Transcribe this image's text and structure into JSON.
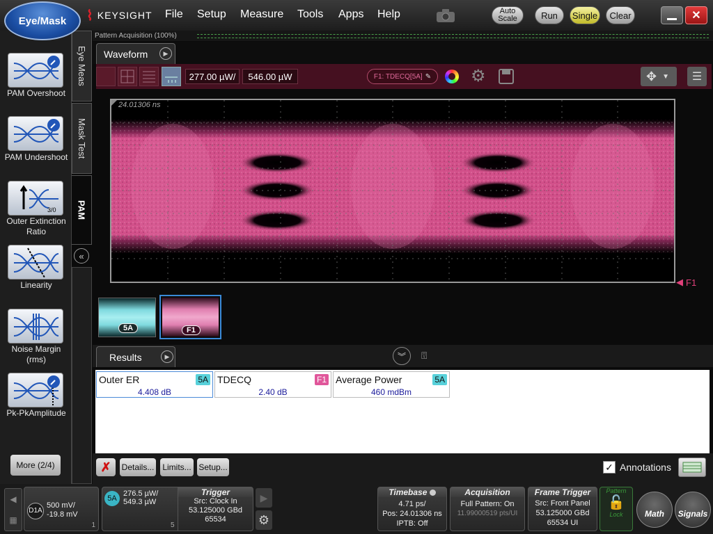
{
  "app": {
    "mode_button": "Eye/Mask",
    "brand": "KEYSIGHT"
  },
  "menu": [
    "File",
    "Setup",
    "Measure",
    "Tools",
    "Apps",
    "Help"
  ],
  "controls": {
    "auto_scale": "Auto Scale",
    "run": "Run",
    "single": "Single",
    "clear": "Clear"
  },
  "left_measurements": [
    {
      "label": "PAM Overshoot"
    },
    {
      "label": "PAM Undershoot"
    },
    {
      "label": "Outer Extinction Ratio"
    },
    {
      "label": "Linearity"
    },
    {
      "label": "Noise Margin (rms)"
    },
    {
      "label": "Pk-PkAmplitude"
    }
  ],
  "more_button": "More (2/4)",
  "vertical_tabs": [
    "Eye Meas",
    "Mask Test",
    "PAM"
  ],
  "pattern_bar": "Pattern Acquisition  (100%)",
  "waveform": {
    "tab": "Waveform",
    "scale_value": "277.00 µW/",
    "offset_value": "546.00 µW",
    "function_label": "F1: TDECQ[5A]",
    "timestamp": "24.01306 ns",
    "marker_label": "F1",
    "thumbnails": [
      {
        "label": "5A",
        "color": "#7fd9de"
      },
      {
        "label": "F1",
        "color": "#e07fb0"
      }
    ]
  },
  "results": {
    "tab": "Results",
    "items": [
      {
        "name": "Outer ER",
        "badge": "5A",
        "value": "4.408 dB",
        "badge_color": "#58d1da"
      },
      {
        "name": "TDECQ",
        "badge": "F1",
        "value": "2.40 dB",
        "badge_color": "#e0569a"
      },
      {
        "name": "Average Power",
        "badge": "5A",
        "value": "460 mdBm",
        "badge_color": "#58d1da"
      }
    ],
    "buttons": {
      "details": "Details...",
      "limits": "Limits...",
      "setup": "Setup..."
    },
    "annotations_label": "Annotations"
  },
  "bottom": {
    "channel_d1a": {
      "label": "D1A",
      "line1": "500 mV/",
      "line2": "-19.8 mV",
      "index": "1"
    },
    "channel_5a": {
      "label": "5A",
      "line1": "276.5 µW/",
      "line2": "549.3 µW",
      "index": "5"
    },
    "trigger": {
      "title": "Trigger",
      "l1": "Src: Clock In",
      "l2": "53.125000 GBd",
      "l3": "65534"
    },
    "timebase": {
      "title": "Timebase",
      "l1": "4.71 ps/",
      "l2": "Pos: 24.01306 ns",
      "l3": "IPTB: Off"
    },
    "acquisition": {
      "title": "Acquisition",
      "l1": "Full Pattern: On",
      "l2": "11.99000519 pts/UI"
    },
    "frame_trigger": {
      "title": "Frame Trigger",
      "l1": "Src: Front Panel",
      "l2": "53.125000 GBd",
      "l3": "65534 UI"
    },
    "pattern_lock": {
      "top": "Pattern",
      "bottom": "Lock"
    },
    "math": "Math",
    "signals": "Signals"
  }
}
